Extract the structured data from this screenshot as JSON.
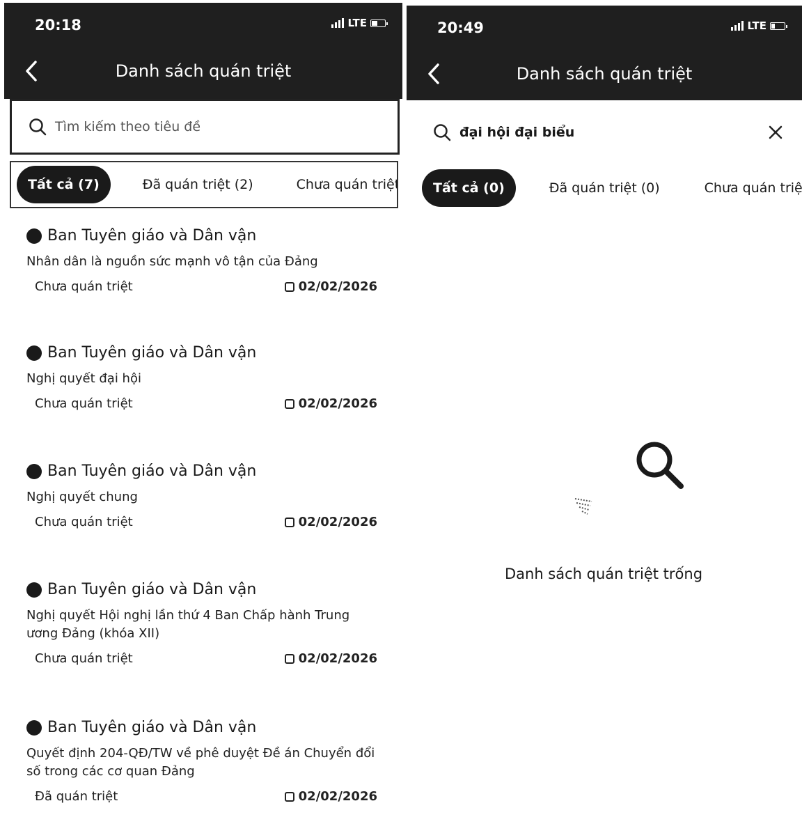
{
  "left": {
    "status": {
      "time": "20:18",
      "network": "LTE"
    },
    "header": {
      "title": "Danh sách quán triệt"
    },
    "search": {
      "placeholder": "Tìm kiếm theo tiêu đề"
    },
    "tabs": [
      {
        "label": "Tất cả (7)",
        "active": true
      },
      {
        "label": "Đã quán triệt (2)",
        "active": false
      },
      {
        "label": "Chưa quán triệt",
        "active": false
      }
    ],
    "items": [
      {
        "org": "Ban Tuyên giáo và Dân vận",
        "title": "Nhân dân là nguồn sức mạnh vô tận của Đảng",
        "status": "Chưa quán triệt",
        "date": "02/02/2026"
      },
      {
        "org": "Ban Tuyên giáo và Dân vận",
        "title": "Nghị quyết đại hội",
        "status": "Chưa quán triệt",
        "date": "02/02/2026"
      },
      {
        "org": "Ban Tuyên giáo và Dân vận",
        "title": "Nghị quyết chung",
        "status": "Chưa quán triệt",
        "date": "02/02/2026"
      },
      {
        "org": "Ban Tuyên giáo và Dân vận",
        "title": "Nghị quyết Hội nghị lần thứ 4 Ban Chấp hành Trung ương Đảng (khóa XII)",
        "status": "Chưa quán triệt",
        "date": "02/02/2026"
      },
      {
        "org": "Ban Tuyên giáo và Dân vận",
        "title": "Quyết định 204-QĐ/TW về phê duyệt Đề án Chuyển đổi số trong các cơ quan Đảng",
        "status": "Đã quán triệt",
        "date": "02/02/2026"
      }
    ]
  },
  "right": {
    "status": {
      "time": "20:49",
      "network": "LTE"
    },
    "header": {
      "title": "Danh sách quán triệt"
    },
    "search": {
      "value": "đại hội đại biểu"
    },
    "tabs": [
      {
        "label": "Tất cả (0)",
        "active": true
      },
      {
        "label": "Đã quán triệt (0)",
        "active": false
      },
      {
        "label": "Chưa quán triệt",
        "active": false
      }
    ],
    "empty": {
      "message": "Danh sách quán triệt trống"
    }
  }
}
